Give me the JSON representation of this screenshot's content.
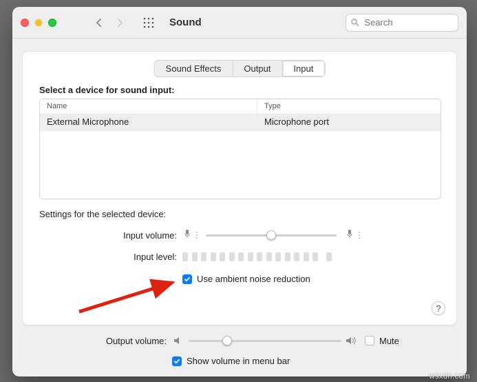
{
  "window": {
    "title": "Sound"
  },
  "search": {
    "placeholder": "Search"
  },
  "tabs": {
    "effects": "Sound Effects",
    "output": "Output",
    "input": "Input"
  },
  "input_section": {
    "heading": "Select a device for sound input:",
    "col_name": "Name",
    "col_type": "Type",
    "row0_name": "External Microphone",
    "row0_type": "Microphone port"
  },
  "settings": {
    "heading": "Settings for the selected device:",
    "input_volume_label": "Input volume:",
    "input_level_label": "Input level:",
    "noise_reduction": "Use ambient noise reduction",
    "help": "?"
  },
  "footer": {
    "output_volume_label": "Output volume:",
    "mute": "Mute",
    "show_menubar": "Show volume in menu bar"
  },
  "watermark": "wsxdn.com"
}
